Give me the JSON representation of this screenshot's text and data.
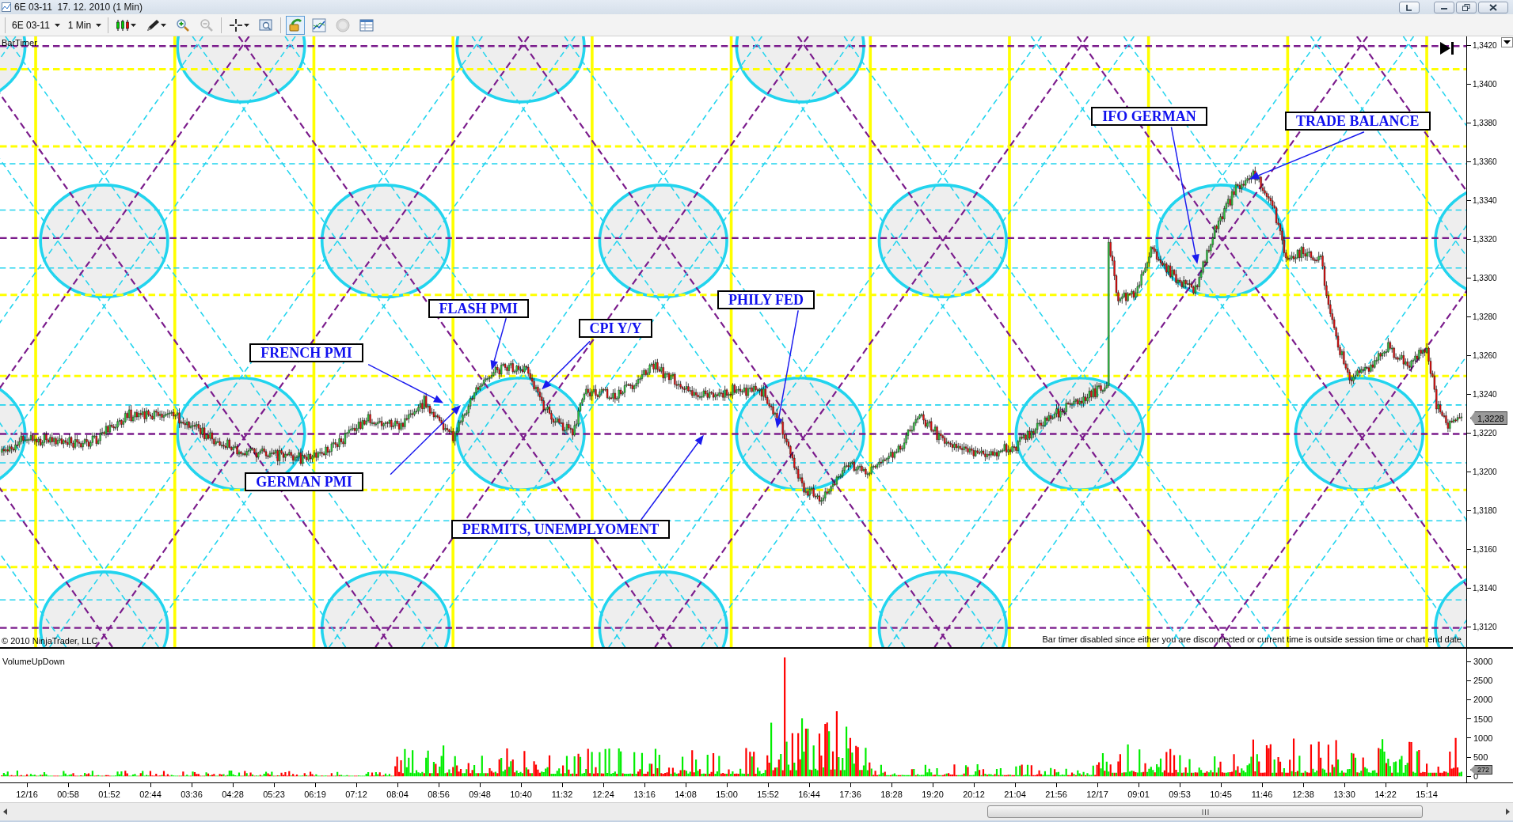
{
  "window": {
    "title": "6E 03-11  17. 12. 2010 (1 Min)"
  },
  "toolbar": {
    "instrument": "6E 03-11",
    "interval": "1 Min"
  },
  "price_panel": {
    "indicator_label": "BarTimer",
    "copyright": "© 2010 NinjaTrader, LLC",
    "message": "Bar timer disabled since either you are disconnected or current time is outside session time or chart end date",
    "axis_ticks": [
      "1,3420",
      "1,3400",
      "1,3380",
      "1,3360",
      "1,3340",
      "1,3320",
      "1,3300",
      "1,3280",
      "1,3260",
      "1,3240",
      "1,3220",
      "1,3200",
      "1,3180",
      "1,3160",
      "1,3140",
      "1,3120"
    ],
    "last_price": "1,3228",
    "annotations": [
      {
        "label": "FRENCH PMI"
      },
      {
        "label": "FLASH PMI"
      },
      {
        "label": "CPI Y/Y"
      },
      {
        "label": "PHILY FED"
      },
      {
        "label": "IFO GERMAN"
      },
      {
        "label": "TRADE BALANCE"
      },
      {
        "label": "GERMAN PMI"
      },
      {
        "label": "PERMITS, UNEMPLYOMENT"
      }
    ]
  },
  "volume_panel": {
    "label": "VolumeUpDown",
    "axis_ticks": [
      "3000",
      "2500",
      "2000",
      "1500",
      "1000",
      "500",
      "0"
    ],
    "last_value": "272"
  },
  "time_axis": [
    "12/16",
    "00:58",
    "01:52",
    "02:44",
    "03:36",
    "04:28",
    "05:23",
    "06:19",
    "07:12",
    "08:04",
    "08:56",
    "09:48",
    "10:40",
    "11:32",
    "12:24",
    "13:16",
    "14:08",
    "15:00",
    "15:52",
    "16:44",
    "17:36",
    "18:28",
    "19:20",
    "20:12",
    "21:04",
    "21:56",
    "12/17",
    "09:01",
    "09:53",
    "10:45",
    "11:46",
    "12:38",
    "13:30",
    "14:22",
    "15:14"
  ]
}
